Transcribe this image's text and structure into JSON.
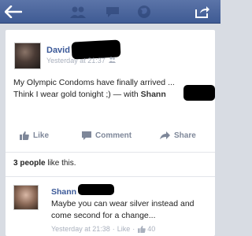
{
  "post": {
    "author": "David",
    "timestamp": "Yesterday at 21:37",
    "text_line1": "My Olympic Condoms have finally arrived ...",
    "text_line2": "Think I wear gold tonight ;) — with ",
    "tagged": "Shann"
  },
  "actions": {
    "like_label": "Like",
    "comment_label": "Comment",
    "share_label": "Share"
  },
  "likes_summary": {
    "count_text": "3 people",
    "suffix": " like this."
  },
  "comment": {
    "author": "Shann",
    "text": "Maybe you can wear silver instead and come second for a change...",
    "timestamp": "Yesterday at 21:38",
    "sep": "·",
    "like_label": "Like",
    "like_count": "40"
  },
  "colors": {
    "brand_blue": "#3b5998",
    "header_blue": "#4c66a4",
    "meta_gray": "#a9b0bd"
  },
  "icons": [
    "back-arrow-icon",
    "friend-requests-icon",
    "messages-icon",
    "notifications-globe-icon",
    "share-out-icon",
    "thumb-up-icon",
    "comment-icon",
    "share-arrow-icon"
  ]
}
